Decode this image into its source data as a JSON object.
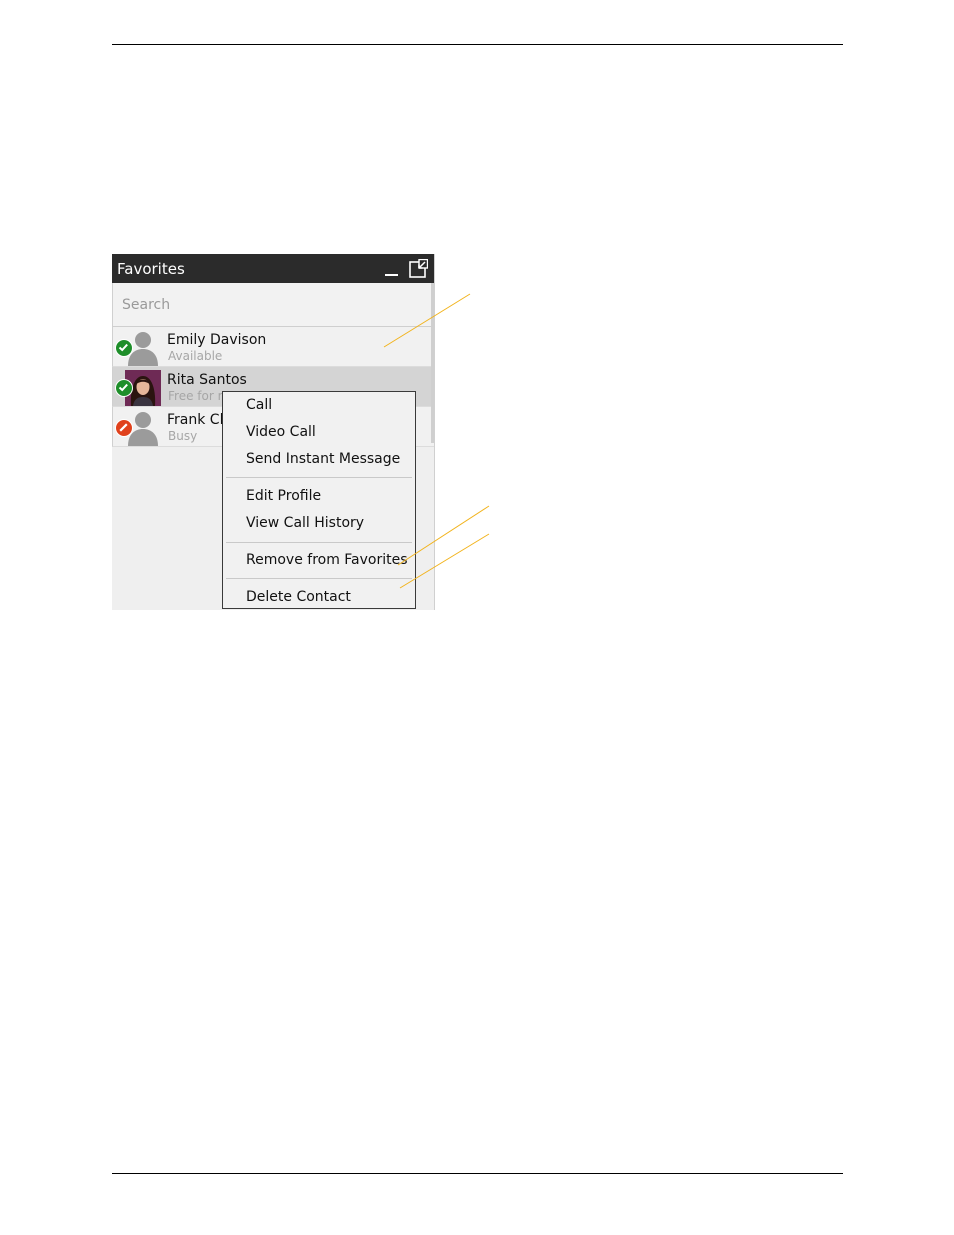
{
  "panel": {
    "title": "Favorites",
    "search": {
      "placeholder": "Search",
      "value": ""
    },
    "contacts": [
      {
        "name": "Emily Davison",
        "status_text": "Available",
        "presence": "available",
        "avatar": "default-avatar"
      },
      {
        "name": "Rita Santos",
        "status_text": "Free for r",
        "presence": "available",
        "avatar": "photo-avatar",
        "selected": true
      },
      {
        "name": "Frank Cl",
        "status_text": "Busy",
        "presence": "busy",
        "avatar": "default-avatar"
      }
    ]
  },
  "context_menu": {
    "items": [
      {
        "label": "Call"
      },
      {
        "label": "Video Call"
      },
      {
        "label": "Send Instant Message"
      },
      {
        "label": "Edit Profile"
      },
      {
        "label": "View Call History"
      },
      {
        "label": "Remove from Favorites"
      },
      {
        "label": "Delete Contact"
      }
    ]
  },
  "colors": {
    "titlebar": "#2b2b2b",
    "available": "#1e8e2a",
    "busy": "#e0411c",
    "callout_line": "#f2b31b",
    "selected_row": "#d4d4d4"
  }
}
